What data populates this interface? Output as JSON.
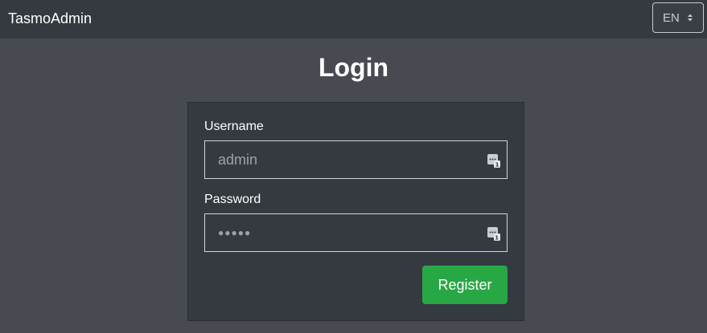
{
  "navbar": {
    "brand": "TasmoAdmin",
    "language": {
      "selected": "EN"
    }
  },
  "main": {
    "title": "Login",
    "form": {
      "username_label": "Username",
      "username_value": "admin",
      "password_label": "Password",
      "password_mask": "●●●●●",
      "submit_label": "Register"
    }
  },
  "colors": {
    "navbar_bg": "#343a40",
    "page_bg": "#474b51",
    "button_green": "#28a745"
  },
  "icons": {
    "autofill": "password-manager-autofill-icon",
    "select_arrows": "select-sort-arrows-icon"
  }
}
